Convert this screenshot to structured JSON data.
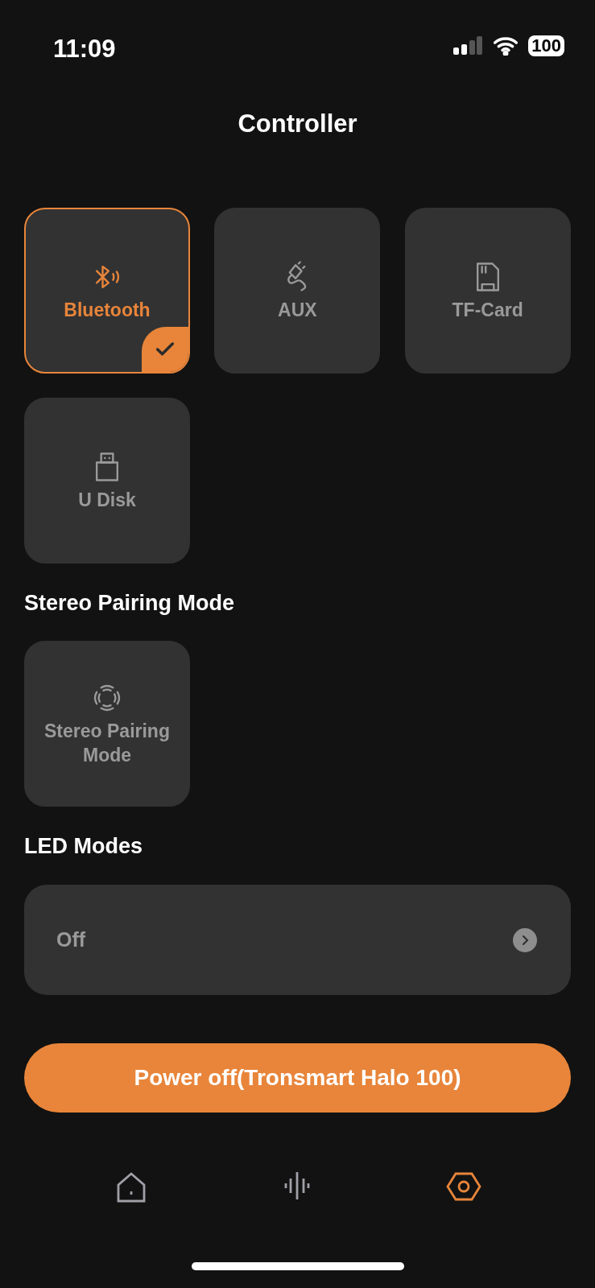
{
  "status_bar": {
    "time": "11:09",
    "battery": "100"
  },
  "title": "Controller",
  "sources": [
    {
      "kind": "bluetooth",
      "label": "Bluetooth",
      "selected": true
    },
    {
      "kind": "aux",
      "label": "AUX",
      "selected": false
    },
    {
      "kind": "tf-card",
      "label": "TF-Card",
      "selected": false
    },
    {
      "kind": "u-disk",
      "label": "U Disk",
      "selected": false
    }
  ],
  "stereo": {
    "heading": "Stereo Pairing Mode",
    "tile": {
      "kind": "stereo",
      "label": "Stereo Pairing Mode",
      "selected": false
    }
  },
  "led": {
    "heading": "LED Modes",
    "value": "Off"
  },
  "power_button": "Power off(Tronsmart Halo 100)",
  "nav": [
    {
      "kind": "home",
      "selected": false
    },
    {
      "kind": "sound",
      "selected": false
    },
    {
      "kind": "settings",
      "selected": true
    }
  ]
}
